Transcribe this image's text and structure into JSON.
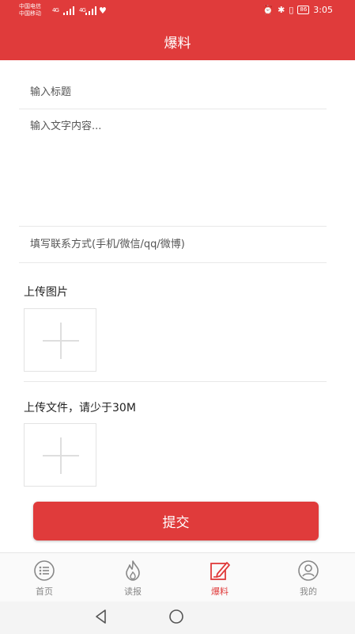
{
  "status_bar": {
    "carrier_1": "中国电信",
    "carrier_2": "中国移动",
    "signal_1": "4G",
    "signal_2": "4G",
    "battery": "86",
    "time": "3:05"
  },
  "header": {
    "title": "爆料"
  },
  "form": {
    "title_placeholder": "输入标题",
    "content_placeholder": "输入文字内容...",
    "contact_placeholder": "填写联系方式(手机/微信/qq/微博)"
  },
  "upload_image": {
    "label": "上传图片"
  },
  "upload_file": {
    "label": "上传文件，请少于30M"
  },
  "submit": {
    "label": "提交"
  },
  "tabs": [
    {
      "label": "首页",
      "icon": "home-list-icon"
    },
    {
      "label": "读报",
      "icon": "flame-icon"
    },
    {
      "label": "爆料",
      "icon": "edit-icon",
      "active": true
    },
    {
      "label": "我的",
      "icon": "user-icon"
    }
  ],
  "colors": {
    "accent": "#e03b3b",
    "inactive": "#888888"
  }
}
